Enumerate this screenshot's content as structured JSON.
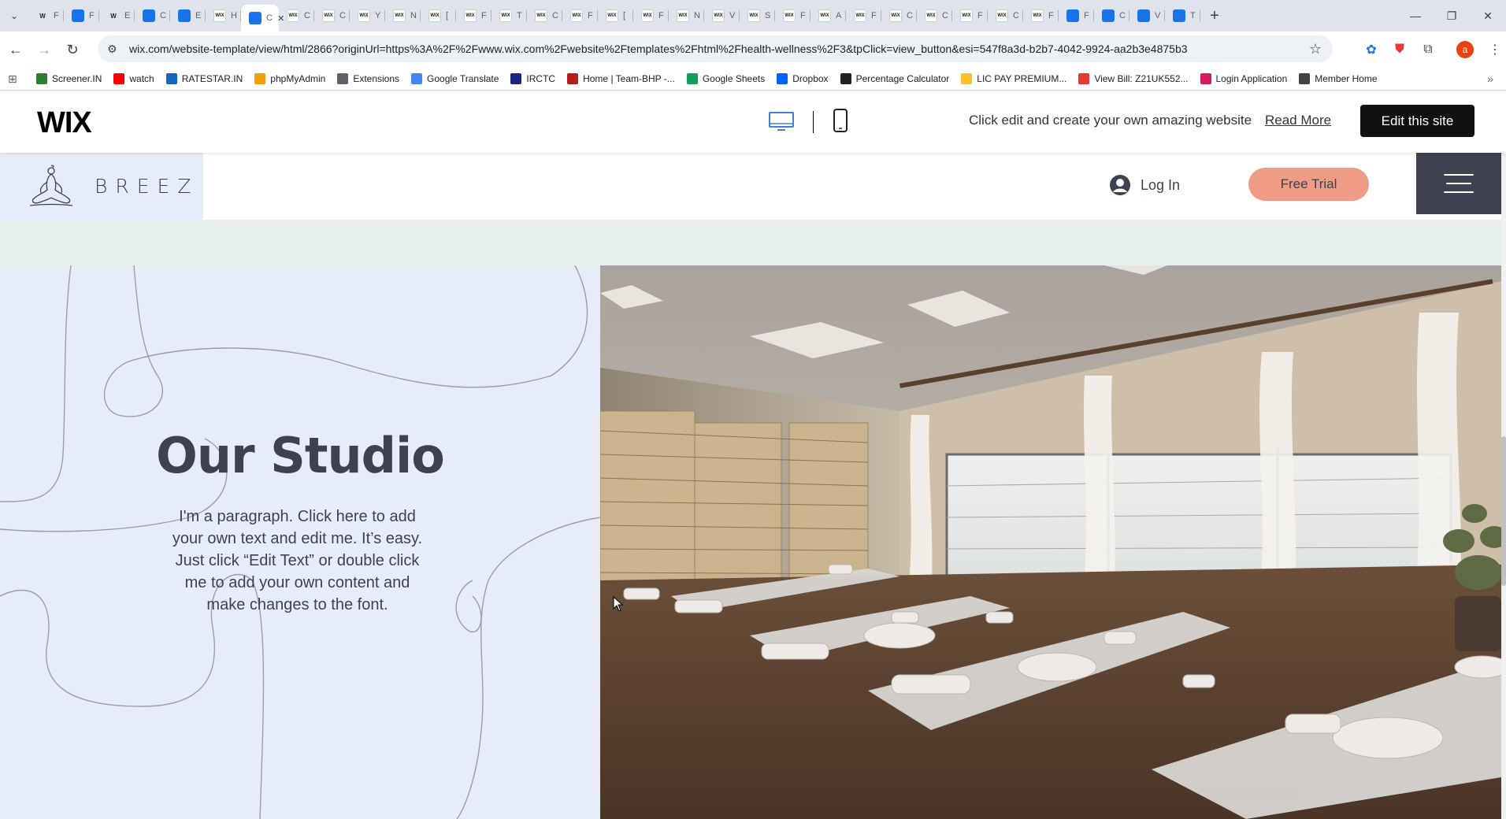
{
  "browser": {
    "tabs": [
      {
        "letter": "W",
        "label": "F"
      },
      {
        "letter": "",
        "label": "F"
      },
      {
        "letter": "W",
        "label": "E"
      },
      {
        "letter": "",
        "label": "C"
      },
      {
        "letter": "",
        "label": "E"
      },
      {
        "letter": "WIX",
        "label": "H"
      },
      {
        "letter": "",
        "label": "C"
      },
      {
        "letter": "WIX",
        "label": "C"
      },
      {
        "letter": "WIX",
        "label": "C"
      },
      {
        "letter": "WIX",
        "label": "Y"
      },
      {
        "letter": "WIX",
        "label": "N"
      },
      {
        "letter": "WIX",
        "label": "["
      },
      {
        "letter": "WIX",
        "label": "F"
      },
      {
        "letter": "WIX",
        "label": "T"
      },
      {
        "letter": "WIX",
        "label": "C"
      },
      {
        "letter": "WIX",
        "label": "F"
      },
      {
        "letter": "WIX",
        "label": "["
      },
      {
        "letter": "WIX",
        "label": "F"
      },
      {
        "letter": "WIX",
        "label": "N"
      },
      {
        "letter": "WIX",
        "label": "V"
      },
      {
        "letter": "WIX",
        "label": "S"
      },
      {
        "letter": "WIX",
        "label": "F"
      },
      {
        "letter": "WIX",
        "label": "A"
      },
      {
        "letter": "WIX",
        "label": "F"
      },
      {
        "letter": "WIX",
        "label": "C"
      },
      {
        "letter": "WIX",
        "label": "C"
      },
      {
        "letter": "WIX",
        "label": "F"
      },
      {
        "letter": "WIX",
        "label": "C"
      },
      {
        "letter": "WIX",
        "label": "F"
      },
      {
        "letter": "",
        "label": "F"
      },
      {
        "letter": "",
        "label": "C"
      },
      {
        "letter": "",
        "label": "V"
      },
      {
        "letter": "",
        "label": "T"
      }
    ],
    "url": "wix.com/website-template/view/html/2866?originUrl=https%3A%2F%2Fwww.wix.com%2Fwebsite%2Ftemplates%2Fhtml%2Fhealth-wellness%2F3&tpClick=view_button&esi=547f8a3d-b2b7-4042-9924-aa2b3e4875b3",
    "profile_initial": "a",
    "bookmarks": [
      {
        "label": "Screener.IN",
        "color": "#2e7d32"
      },
      {
        "label": "watch",
        "color": "#ff0000"
      },
      {
        "label": "RATESTAR.IN",
        "color": "#1565c0"
      },
      {
        "label": "phpMyAdmin",
        "color": "#f59e0b"
      },
      {
        "label": "Extensions",
        "color": "#5f6368"
      },
      {
        "label": "Google Translate",
        "color": "#4285f4"
      },
      {
        "label": "IRCTC",
        "color": "#1a237e"
      },
      {
        "label": "Home | Team-BHP -...",
        "color": "#b71c1c"
      },
      {
        "label": "Google Sheets",
        "color": "#0f9d58"
      },
      {
        "label": "Dropbox",
        "color": "#0061fe"
      },
      {
        "label": "Percentage Calculator",
        "color": "#222222"
      },
      {
        "label": "LIC PAY PREMIUM...",
        "color": "#fbc02d"
      },
      {
        "label": "View Bill: Z21UK552...",
        "color": "#e53935"
      },
      {
        "label": "Login Application",
        "color": "#d81b60"
      },
      {
        "label": "Member Home",
        "color": "#424242"
      }
    ]
  },
  "wix_bar": {
    "logo": "WIX",
    "message": "Click edit and create your own amazing website",
    "read_more": "Read More",
    "edit_button": "Edit this site"
  },
  "site": {
    "brand": "BREEZ",
    "login": "Log In",
    "free_trial": "Free Trial",
    "hero_title": "Our Studio",
    "hero_paragraph": "I'm a paragraph. Click here to add your own text and edit me. It’s easy. Just click “Edit Text” or double click me to add your own content and make changes to the font.",
    "colors": {
      "accent": "#ef9b86",
      "dark": "#3d4150",
      "panel": "#e7edf8",
      "strip": "#e8f0ee"
    }
  }
}
